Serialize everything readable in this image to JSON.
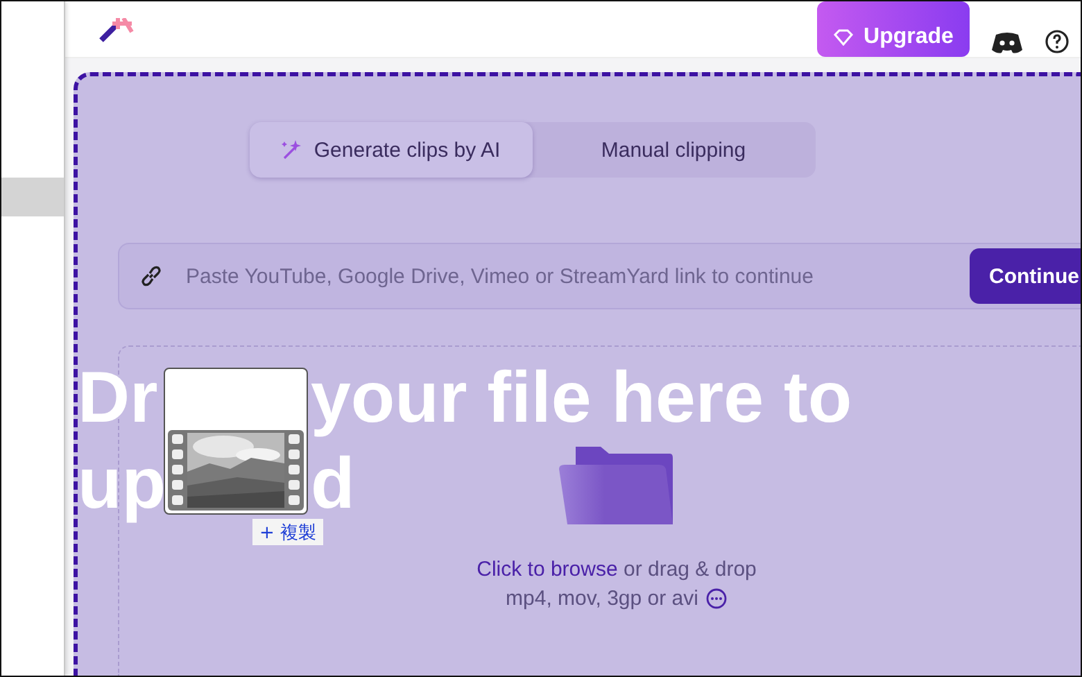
{
  "header": {
    "upgrade_button": "Upgrade"
  },
  "tabs": [
    {
      "label": "Generate clips by AI",
      "selected": true
    },
    {
      "label": "Manual clipping",
      "selected": false
    }
  ],
  "link_field": {
    "placeholder": "Paste YouTube, Google Drive, Vimeo or StreamYard link to continue",
    "button": "Continue"
  },
  "dropzone": {
    "browse_link": "Click to browse",
    "drop_text": "or drag & drop",
    "formats": "mp4, mov, 3gp or avi"
  },
  "drag_overlay": {
    "heading_parts": [
      [
        "Dr",
        "your file here to"
      ],
      [
        "up",
        "d"
      ]
    ],
    "copy_badge": "+ 複製"
  }
}
